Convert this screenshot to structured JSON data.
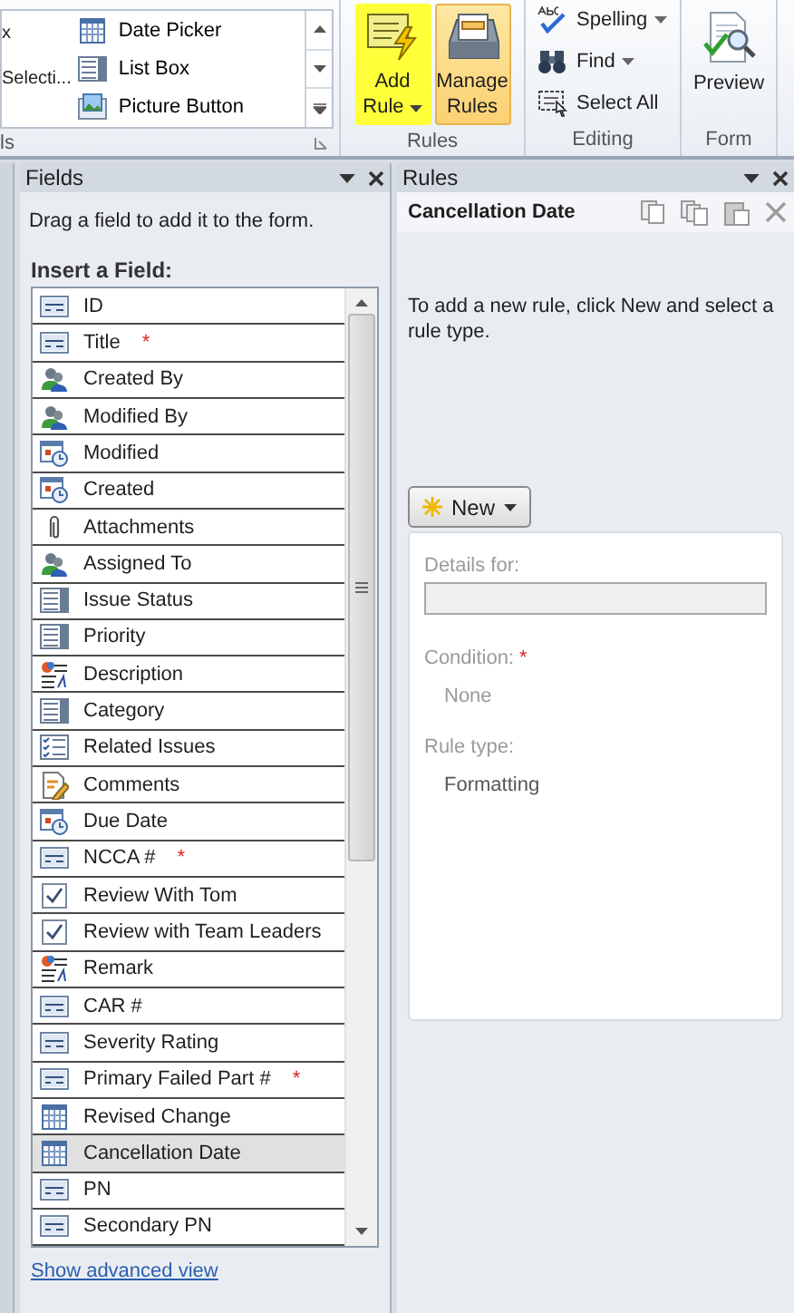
{
  "ribbon": {
    "gallery": {
      "left_items": [
        "x",
        "Selecti..."
      ],
      "items": [
        {
          "label": "Date Picker",
          "kind": "date"
        },
        {
          "label": "List Box",
          "kind": "list"
        },
        {
          "label": "Picture Button",
          "kind": "picture"
        }
      ],
      "group_label": "ls"
    },
    "rules_group": {
      "buttons": [
        {
          "label": "Add Rule",
          "kind": "add",
          "highlighted": true,
          "dropdown": true
        },
        {
          "label": "Manage Rules",
          "kind": "manage",
          "highlighted": false,
          "dropdown": false
        }
      ],
      "label": "Rules"
    },
    "editing_group": {
      "items": [
        {
          "label": "Spelling",
          "kind": "spelling",
          "dropdown": true
        },
        {
          "label": "Find",
          "kind": "find",
          "dropdown": true
        },
        {
          "label": "Select All",
          "kind": "select",
          "dropdown": false
        }
      ],
      "label": "Editing"
    },
    "form_group": {
      "button": "Preview",
      "label": "Form"
    }
  },
  "fields_pane": {
    "title": "Fields",
    "hint": "Drag a field to add it to the form.",
    "heading": "Insert a Field:",
    "link": "Show advanced view",
    "fields": [
      {
        "name": "ID",
        "kind": "text",
        "selected": false
      },
      {
        "name": "Title",
        "kind": "text",
        "required_mark": "*",
        "selected": false
      },
      {
        "name": "Created By",
        "kind": "person",
        "selected": false
      },
      {
        "name": "Modified By",
        "kind": "person",
        "selected": false
      },
      {
        "name": "Modified",
        "kind": "datetime",
        "selected": false
      },
      {
        "name": "Created",
        "kind": "datetime",
        "selected": false
      },
      {
        "name": "Attachments",
        "kind": "attachment",
        "selected": false
      },
      {
        "name": "Assigned To",
        "kind": "person",
        "selected": false
      },
      {
        "name": "Issue Status",
        "kind": "choice",
        "selected": false
      },
      {
        "name": "Priority",
        "kind": "choice",
        "selected": false
      },
      {
        "name": "Description",
        "kind": "richtext",
        "selected": false
      },
      {
        "name": "Category",
        "kind": "choice",
        "selected": false
      },
      {
        "name": "Related Issues",
        "kind": "multichoice",
        "selected": false
      },
      {
        "name": "Comments",
        "kind": "note",
        "selected": false
      },
      {
        "name": "Due Date",
        "kind": "datetime",
        "selected": false
      },
      {
        "name": "NCCA #",
        "kind": "text",
        "required_mark": "*",
        "selected": false
      },
      {
        "name": "Review With Tom",
        "kind": "checkbox",
        "selected": false
      },
      {
        "name": "Review with Team Leaders",
        "kind": "checkbox",
        "selected": false
      },
      {
        "name": "Remark",
        "kind": "richtext",
        "selected": false
      },
      {
        "name": "CAR #",
        "kind": "text",
        "selected": false
      },
      {
        "name": "Severity Rating",
        "kind": "text",
        "selected": false
      },
      {
        "name": "Primary Failed Part #",
        "kind": "text",
        "required_mark": "*",
        "selected": false
      },
      {
        "name": "Revised Change",
        "kind": "date",
        "selected": false
      },
      {
        "name": "Cancellation Date",
        "kind": "date",
        "selected": true
      },
      {
        "name": "PN",
        "kind": "text",
        "selected": false
      },
      {
        "name": "Secondary PN",
        "kind": "text",
        "selected": false
      }
    ]
  },
  "rules_pane": {
    "title": "Rules",
    "field": "Cancellation Date",
    "message": "To add a new rule, click New and select a rule type.",
    "new_button": "New",
    "details": {
      "details_label": "Details for:",
      "condition_label": "Condition:",
      "condition_mark": "*",
      "condition_value": "None",
      "rule_type_label": "Rule type:",
      "rule_type_value": "Formatting"
    }
  }
}
